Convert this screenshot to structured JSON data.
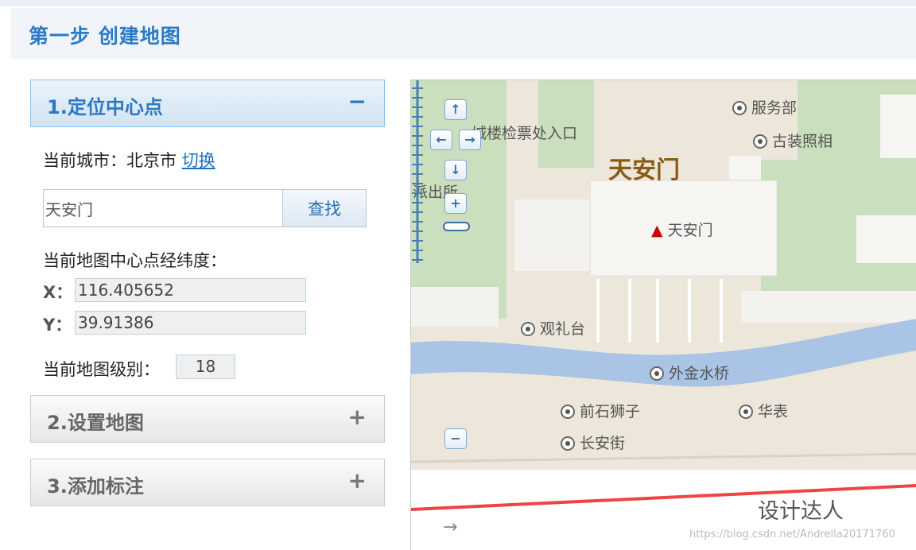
{
  "step": {
    "title": "第一步 创建地图"
  },
  "panels": [
    {
      "title": "1.定位中心点",
      "toggle": "−"
    },
    {
      "title": "2.设置地图",
      "toggle": "+"
    },
    {
      "title": "3.添加标注",
      "toggle": "+"
    }
  ],
  "location": {
    "city_label": "当前城市：北京市",
    "switch_link": "切换",
    "search_value": "天安门",
    "search_button": "查找",
    "center_label": "当前地图中心点经纬度：",
    "x_label": "X：",
    "x_value": "116.405652",
    "y_label": "Y：",
    "y_value": "39.91386",
    "level_label": "当前地图级别：",
    "level_value": "18"
  },
  "map": {
    "labels": {
      "service": "服务部",
      "ticket": "城楼检票处入口",
      "photo": "古装照相",
      "tiananmen_big": "天安门",
      "police": "派出所",
      "tiananmen_poi": "天安门",
      "viewing_stand": "观礼台",
      "golden_bridge": "外金水桥",
      "stone_lions": "前石狮子",
      "huabiao": "华表",
      "changan": "长安街"
    },
    "nav": {
      "up": "↑",
      "left": "←",
      "right": "→",
      "down": "↓",
      "zoom_in": "+",
      "zoom_out": "−"
    },
    "watermark": "设计达人",
    "url_watermark": "https://blog.csdn.net/Andrella20171760",
    "arrow": "→"
  }
}
